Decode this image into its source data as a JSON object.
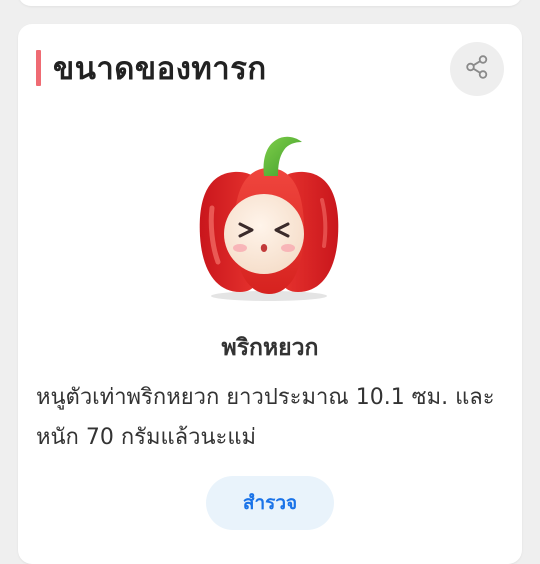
{
  "section": {
    "title": "ขนาดของทารก",
    "accent_color": "#ef6b73",
    "share_icon": "share-icon"
  },
  "baby_size": {
    "illustration": "red-bell-pepper-character",
    "item_name": "พริกหยวก",
    "description": "หนูตัวเท่าพริกหยวก ยาวประมาณ 10.1 ซม. และหนัก 70 กรัมแล้วนะแม่"
  },
  "actions": {
    "explore_label": "สำรวจ",
    "explore_color": "#1a73e8"
  }
}
